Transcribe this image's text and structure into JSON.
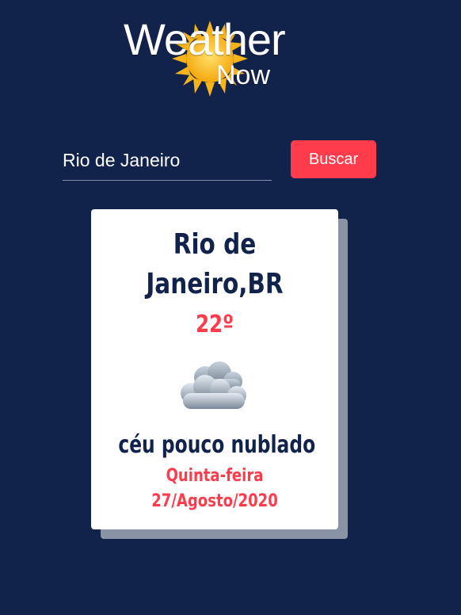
{
  "logo": {
    "line1": "Weather",
    "line2": "Now"
  },
  "search": {
    "value": "Rio de Janeiro",
    "button_label": "Buscar"
  },
  "card": {
    "city_line1": "Rio de",
    "city_line2": "Janeiro,BR",
    "temperature": "22º",
    "condition_icon": "cloud-icon",
    "description": "céu pouco nublado",
    "weekday": "Quinta-feira",
    "date": "27/Agosto/2020"
  },
  "colors": {
    "background": "#12234b",
    "accent": "#ff3b4c",
    "card": "#ffffff",
    "card_shadow": "#8a93a5"
  }
}
